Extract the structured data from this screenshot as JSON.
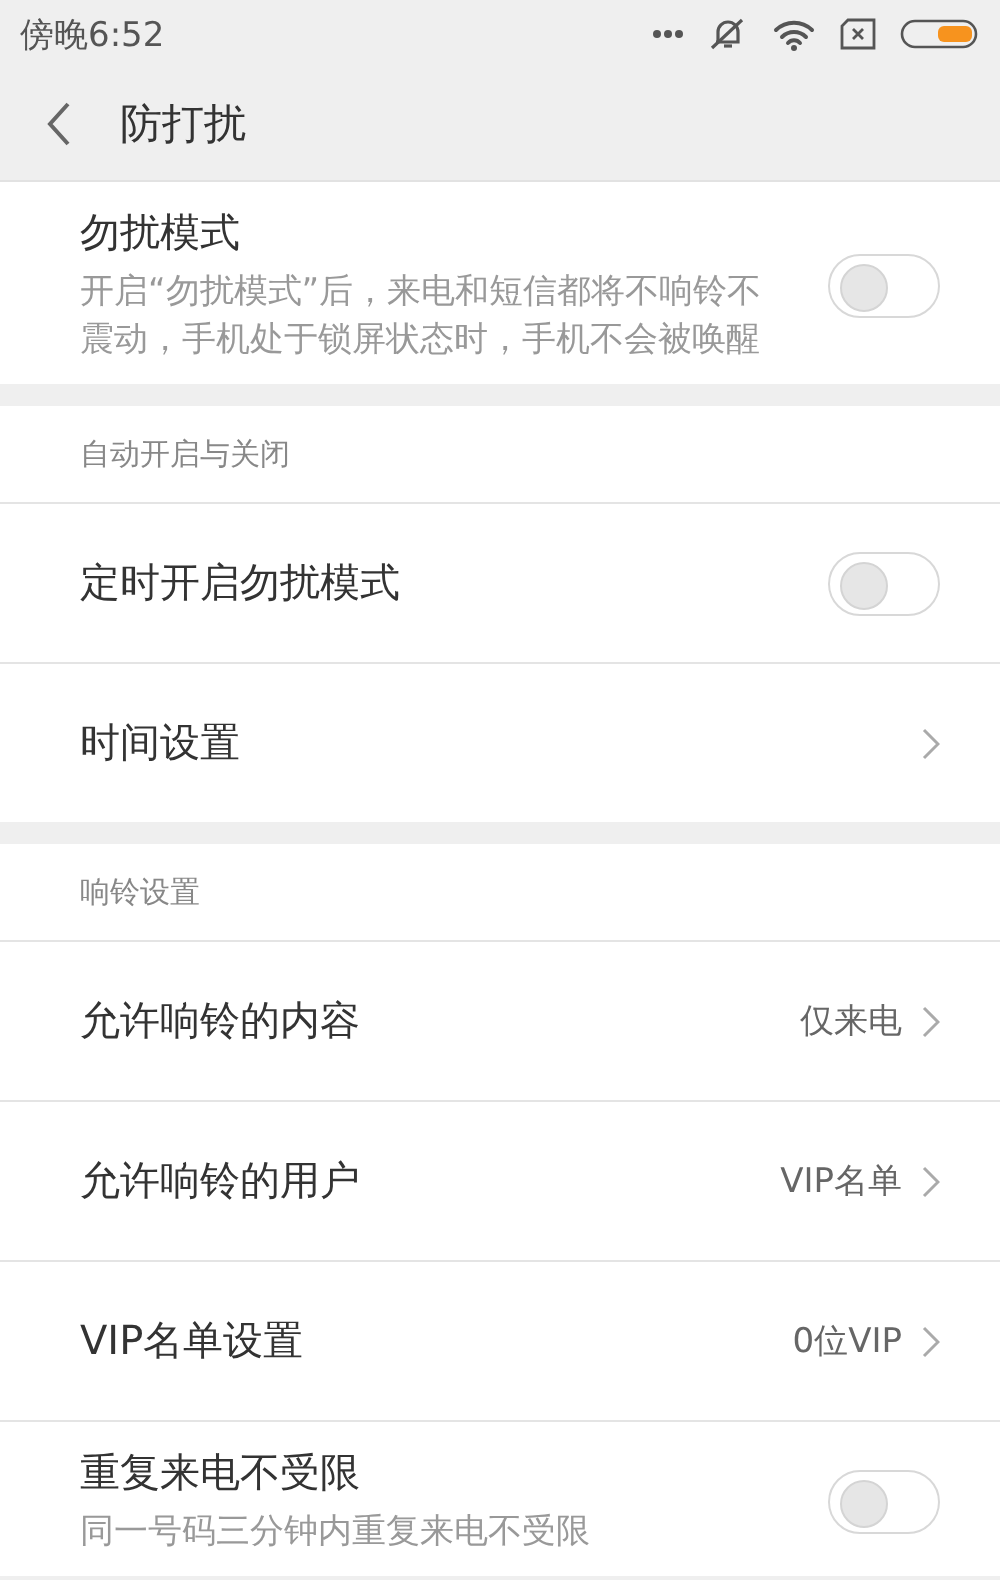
{
  "status_bar": {
    "time": "傍晚6:52"
  },
  "header": {
    "title": "防打扰"
  },
  "sections": [
    {
      "items": [
        {
          "kind": "toggle",
          "label": "勿扰模式",
          "description": "开启“勿扰模式”后，来电和短信都将不响铃不震动，手机处于锁屏状态时，手机不会被唤醒",
          "on": false
        }
      ]
    },
    {
      "title": "自动开启与关闭",
      "items": [
        {
          "kind": "toggle",
          "label": "定时开启勿扰模式",
          "on": false
        },
        {
          "kind": "link",
          "label": "时间设置"
        }
      ]
    },
    {
      "title": "响铃设置",
      "items": [
        {
          "kind": "link",
          "label": "允许响铃的内容",
          "value": "仅来电"
        },
        {
          "kind": "link",
          "label": "允许响铃的用户",
          "value": "VIP名单"
        },
        {
          "kind": "link",
          "label": "VIP名单设置",
          "value": "0位VIP"
        },
        {
          "kind": "toggle",
          "label": "重复来电不受限",
          "description": "同一号码三分钟内重复来电不受限",
          "on": false
        }
      ]
    }
  ]
}
